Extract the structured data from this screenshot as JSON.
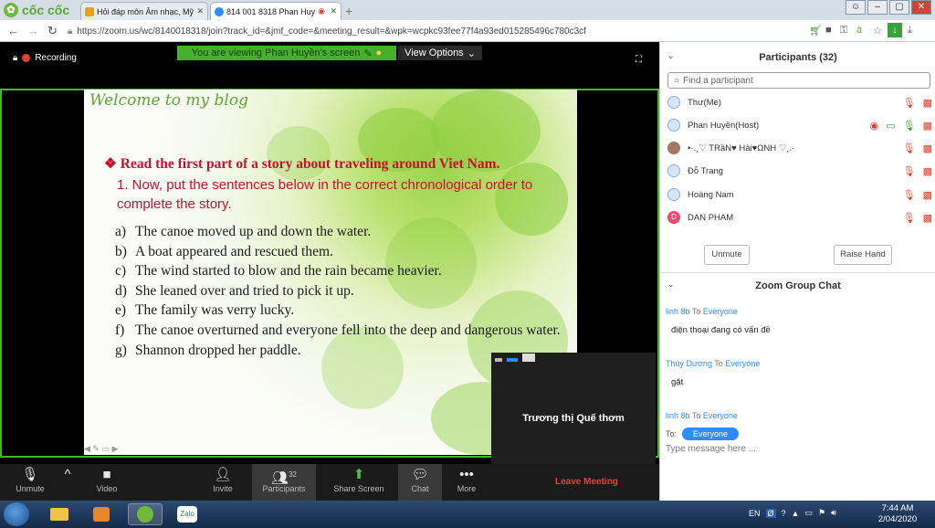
{
  "browser": {
    "brand": "cốc cốc",
    "tabs": [
      {
        "title": "Hỏi đáp môn Âm nhạc, Mỹ",
        "active": false
      },
      {
        "title": "814 001 8318 Phan Huy",
        "active": true
      }
    ],
    "url": "https://zoom.us/wc/8140018318/join?track_id=&jmf_code=&meeting_result=&wpk=wcpkc93fee77f4a93ed015285496c780c3cf"
  },
  "meeting": {
    "recording_label": "Recording",
    "viewing_banner": "You are viewing Phan Huyền's screen",
    "view_options_label": "View Options",
    "slide": {
      "blog_title": "Welcome to my blog",
      "heading": "❖ Read the first part of a story about traveling around Viet Nam.",
      "instruction": "1.  Now, put the sentences below in the correct chronological order to complete the story.",
      "items": [
        {
          "letter": "a)",
          "text": "The canoe moved up and down the water."
        },
        {
          "letter": "b)",
          "text": "A boat appeared and rescued them."
        },
        {
          "letter": "c)",
          "text": "The wind started to blow and the rain became heavier."
        },
        {
          "letter": "d)",
          "text": "She leaned over and tried to pick it up."
        },
        {
          "letter": "e)",
          "text": "The family was verry lucky."
        },
        {
          "letter": "f)",
          "text": "The canoe overturned and everyone fell into the deep and dangerous water."
        },
        {
          "letter": "g)",
          "text": "Shannon dropped her paddle."
        }
      ]
    },
    "self_view_name": "Trương thị Quế thơm"
  },
  "toolbar": {
    "unmute": "Unmute",
    "video": "Video",
    "invite": "Invite",
    "participants": "Participants",
    "participants_count": "32",
    "share_screen": "Share Screen",
    "chat": "Chat",
    "more": "More",
    "leave": "Leave Meeting"
  },
  "participants_panel": {
    "title": "Participants (32)",
    "search_placeholder": "Find a participant",
    "list": [
      {
        "name": "Thư(Me)",
        "avatar_color": "#d7e6f7"
      },
      {
        "name": "Phan Huyền(Host)",
        "avatar_color": "#d7e6f7"
      },
      {
        "name": "•·.¸♡ TRầN♥ Hải♥ΩNH ♡¸.·",
        "avatar_color": "#a07a68"
      },
      {
        "name": "Đỗ Trang",
        "avatar_color": "#d7e6f7"
      },
      {
        "name": "Hoàng Nam",
        "avatar_color": "#d7e6f7"
      },
      {
        "name": "DAN PHAM",
        "avatar_color": "#e84b6a",
        "initial": "D"
      }
    ],
    "unmute_button": "Unmute",
    "raise_hand_button": "Raise Hand"
  },
  "chat_panel": {
    "title": "Zoom Group Chat",
    "to_word": "To",
    "messages": [
      {
        "from": "linh 8b",
        "to": "Everyone",
        "text": "điện thoại đang có vấn đề"
      },
      {
        "from": "Thùy Dương",
        "to": "Everyone",
        "text": "gặt"
      },
      {
        "from": "linh 8b",
        "to": "Everyone",
        "text": ""
      }
    ],
    "to_label": "To:",
    "recipient": "Everyone",
    "input_placeholder": "Type message here ..."
  },
  "taskbar": {
    "language": "EN",
    "time": "7:44 AM",
    "date": "2/04/2020"
  },
  "colors": {
    "zoom_green": "#44b42a",
    "zoom_blue": "#2d8cff",
    "leave_red": "#e8403a",
    "slide_red": "#c8102e"
  }
}
